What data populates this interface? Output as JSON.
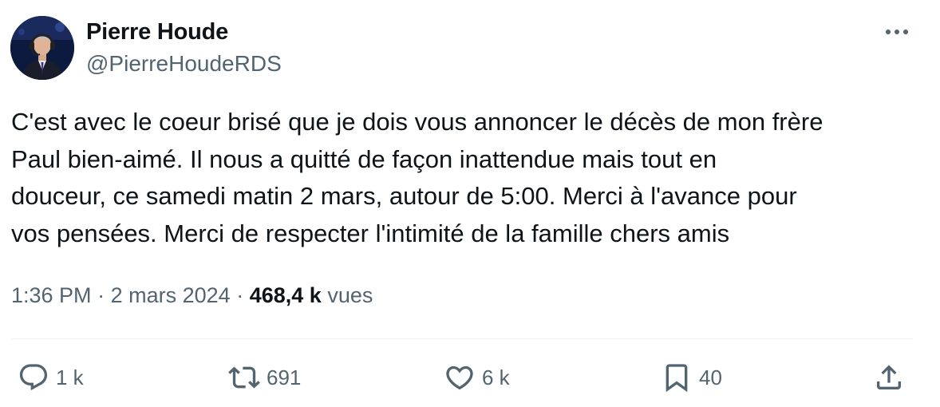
{
  "author": {
    "display_name": "Pierre Houde",
    "handle": "@PierreHoudeRDS"
  },
  "tweet": {
    "lines": [
      "C'est avec le coeur brisé que je dois vous annoncer le décès de mon frère",
      "Paul bien-aimé. Il nous a quitté de façon inattendue mais tout en",
      "douceur, ce samedi matin 2 mars, autour de 5:00. Merci à l'avance pour",
      "vos pensées. Merci de respecter l'intimité de la famille chers amis"
    ]
  },
  "meta": {
    "time": "1:36 PM",
    "separator": "·",
    "date": "2 mars 2024",
    "views_count": "468,4 k",
    "views_label": "vues"
  },
  "actions": {
    "replies": "1 k",
    "reposts": "691",
    "likes": "6 k",
    "bookmarks": "40"
  },
  "icons": {
    "more": "more-icon",
    "reply": "reply-icon",
    "repost": "repost-icon",
    "like": "heart-icon",
    "bookmark": "bookmark-icon",
    "share": "share-icon"
  },
  "colors": {
    "text": "#0f1419",
    "secondary": "#536471",
    "divider": "#eff3f4"
  }
}
